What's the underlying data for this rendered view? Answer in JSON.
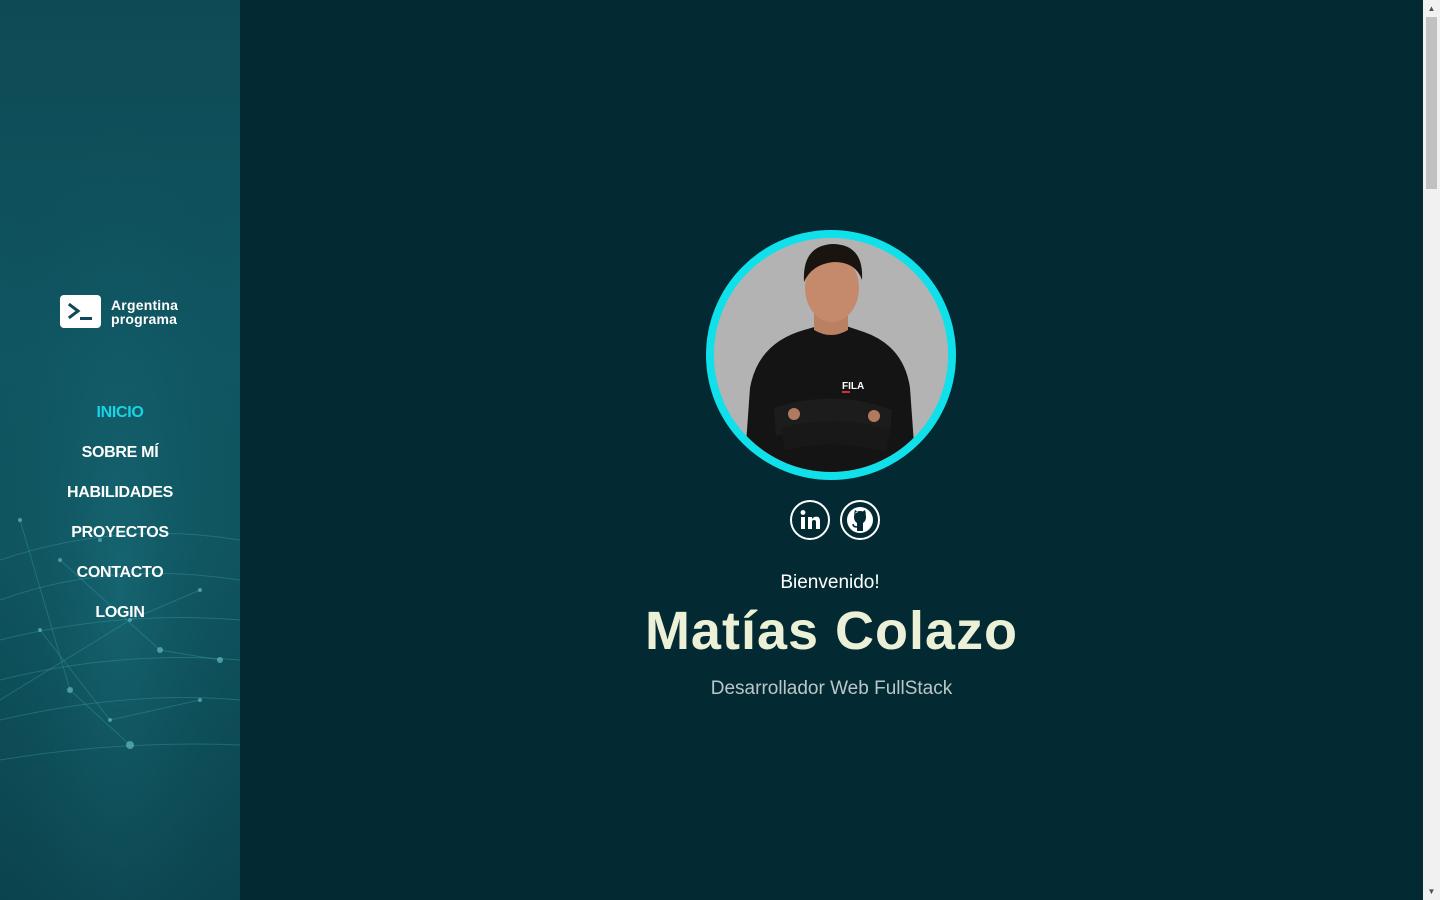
{
  "brand": {
    "line1": "Argentina",
    "line2": "programa",
    "icon": "terminal-prompt-icon"
  },
  "nav": {
    "items": [
      {
        "label": "INICIO",
        "active": true
      },
      {
        "label": "SOBRE MÍ",
        "active": false
      },
      {
        "label": "HABILIDADES",
        "active": false
      },
      {
        "label": "PROYECTOS",
        "active": false
      },
      {
        "label": "CONTACTO",
        "active": false
      },
      {
        "label": "LOGIN",
        "active": false
      }
    ]
  },
  "hero": {
    "greeting": "Bienvenido!",
    "name": "Matías Colazo",
    "role": "Desarrollador Web FullStack",
    "avatar_icon": "profile-photo",
    "shirt_text": "FILA"
  },
  "socials": [
    {
      "name": "linkedin-icon",
      "label": "in"
    },
    {
      "name": "github-icon"
    }
  ],
  "colors": {
    "background": "#032a32",
    "accent": "#0fe0ea",
    "nav_active": "#17d4e6",
    "name": "#ecf0d6"
  }
}
